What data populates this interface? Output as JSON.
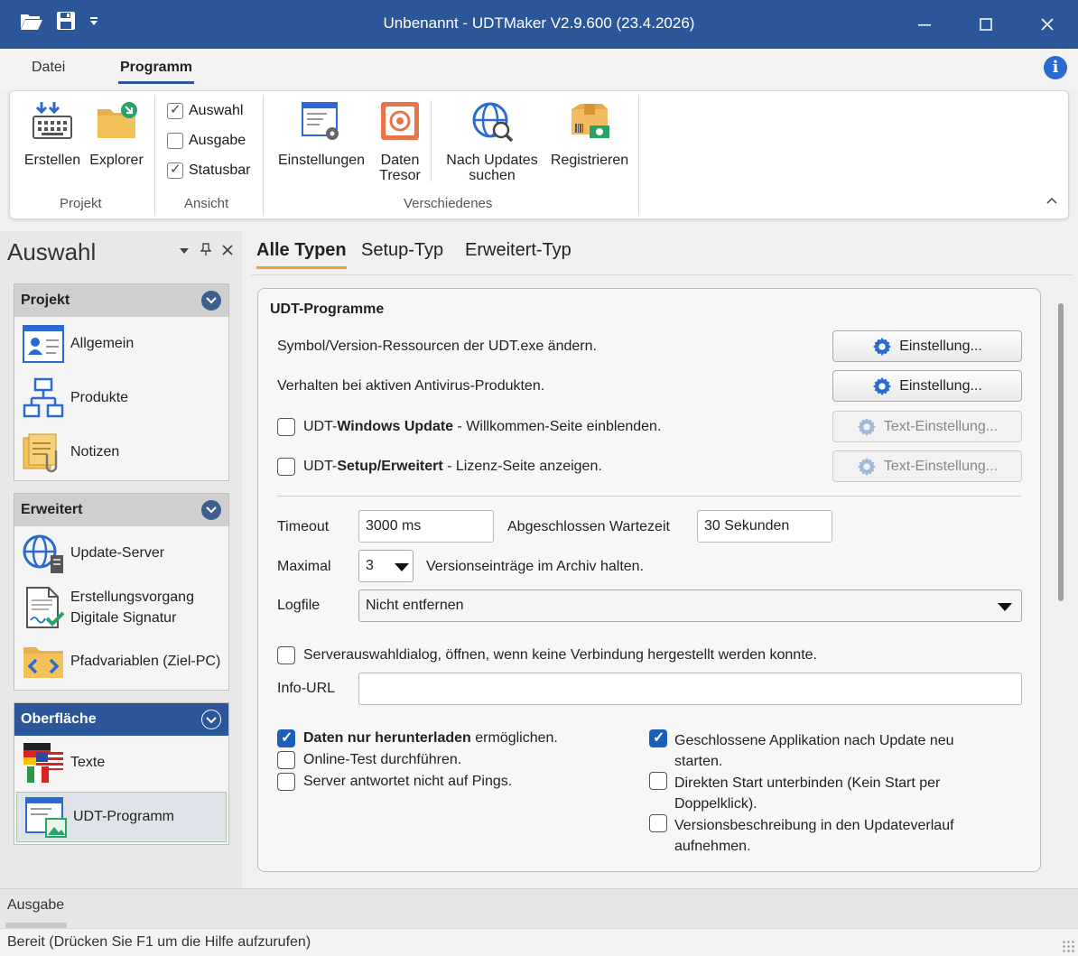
{
  "window": {
    "title": "Unbenannt - UDTMaker V2.9.600 (23.4.2026)"
  },
  "ribbon_tabs": [
    {
      "label": "Datei"
    },
    {
      "label": "Programm"
    }
  ],
  "ribbon": {
    "projekt": {
      "label": "Projekt",
      "buttons": [
        {
          "label": "Erstellen"
        },
        {
          "label": "Explorer"
        }
      ]
    },
    "ansicht": {
      "label": "Ansicht",
      "checks": [
        {
          "label": "Auswahl",
          "checked": true
        },
        {
          "label": "Ausgabe",
          "checked": false
        },
        {
          "label": "Statusbar",
          "checked": true
        }
      ]
    },
    "verschiedenes": {
      "label": "Verschiedenes",
      "buttons": [
        {
          "label": "Einstellungen"
        },
        {
          "label_line1": "Daten",
          "label_line2": "Tresor"
        },
        {
          "label_line1": "Nach Updates",
          "label_line2": "suchen"
        },
        {
          "label": "Registrieren"
        }
      ]
    }
  },
  "left_panel": {
    "title": "Auswahl",
    "sections": [
      {
        "label": "Projekt",
        "items": [
          {
            "label": "Allgemein"
          },
          {
            "label": "Produkte"
          },
          {
            "label": "Notizen"
          }
        ]
      },
      {
        "label": "Erweitert",
        "items": [
          {
            "label": "Update-Server"
          },
          {
            "label_line1": "Erstellungsvorgang",
            "label_line2": "Digitale Signatur"
          },
          {
            "label": "Pfadvariablen (Ziel-PC)"
          }
        ]
      },
      {
        "label": "Oberfläche",
        "items": [
          {
            "label": "Texte"
          },
          {
            "label": "UDT-Programm"
          }
        ]
      }
    ]
  },
  "main_tabs": [
    {
      "label": "Alle Typen"
    },
    {
      "label": "Setup-Typ"
    },
    {
      "label": "Erweitert-Typ"
    }
  ],
  "card": {
    "title": "UDT-Programme",
    "row1": {
      "text": "Symbol/Version-Ressourcen der UDT.exe ändern.",
      "button": "Einstellung..."
    },
    "row2": {
      "text": "Verhalten bei aktiven Antivirus-Produkten.",
      "button": "Einstellung..."
    },
    "row3": {
      "pre": "UDT-",
      "bold": "Windows Update",
      "post": " - Willkommen-Seite einblenden.",
      "button": "Text-Einstellung...",
      "checked": false
    },
    "row4": {
      "pre": "UDT-",
      "bold": "Setup/Erweitert",
      "post": " - Lizenz-Seite anzeigen.",
      "button": "Text-Einstellung...",
      "checked": false
    },
    "timeout": {
      "label": "Timeout",
      "value": "3000 ms"
    },
    "wartezeit": {
      "label": "Abgeschlossen Wartezeit",
      "value": "30 Sekunden"
    },
    "maximal": {
      "label": "Maximal",
      "value": "3",
      "suffix": "Versionseinträge im Archiv halten."
    },
    "logfile": {
      "label": "Logfile",
      "value": "Nicht entfernen"
    },
    "serverdialog": {
      "label": "Serverauswahldialog, öffnen, wenn keine Verbindung hergestellt werden konnte.",
      "checked": false
    },
    "info_url": {
      "label": "Info-URL",
      "value": ""
    },
    "options_left": [
      {
        "bold": "Daten nur herunterladen",
        "post": " ermöglichen.",
        "checked": true
      },
      {
        "label": "Online-Test durchführen.",
        "checked": false
      },
      {
        "label": "Server antwortet nicht auf Pings.",
        "checked": false
      }
    ],
    "options_right": [
      {
        "line1": "Geschlossene Applikation nach Update neu",
        "line2": "starten.",
        "checked": true
      },
      {
        "line1": "Direkten Start unterbinden (Kein Start per",
        "line2": "Doppelklick).",
        "checked": false
      },
      {
        "line1": "Versionsbeschreibung in den Updateverlauf",
        "line2": "aufnehmen.",
        "checked": false
      }
    ]
  },
  "output_panel": {
    "label": "Ausgabe"
  },
  "status": {
    "text": "Bereit (Drücken Sie F1 um die Hilfe aufzurufen)"
  },
  "colors": {
    "titlebar": "#2b579a",
    "accent_tab": "#f0a030",
    "check_blue": "#1b5fb8"
  }
}
